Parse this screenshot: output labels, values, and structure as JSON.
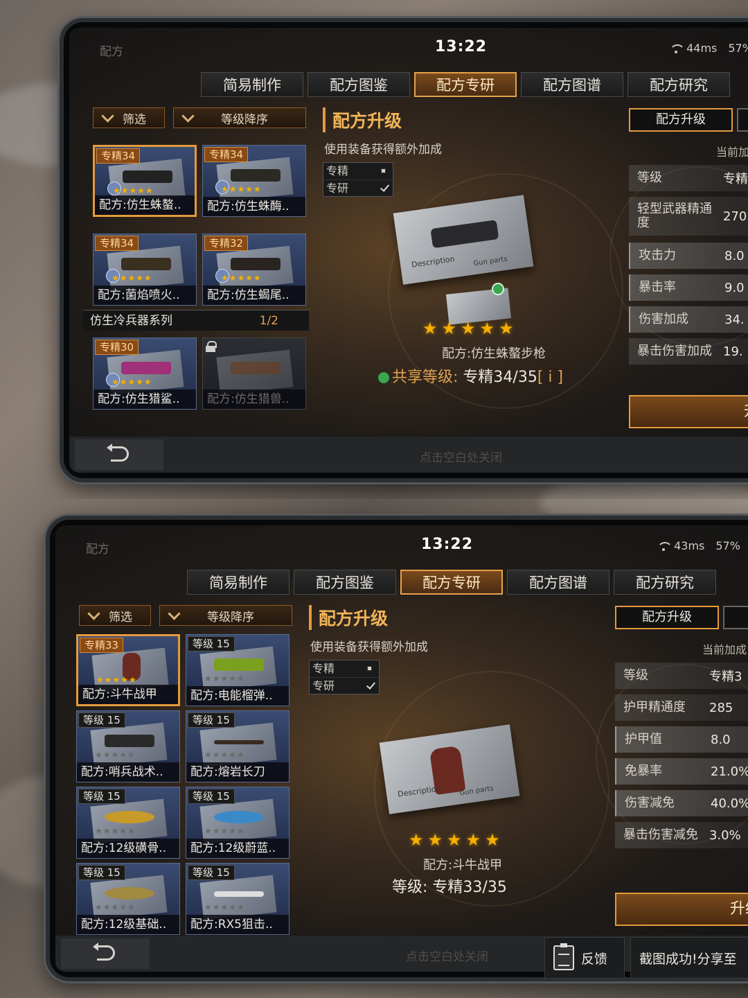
{
  "screenshots": [
    {
      "app_title": "配方",
      "clock": "13:22",
      "ping": "44ms",
      "battery": "57%",
      "tabs": [
        "简易制作",
        "配方图鉴",
        "配方专研",
        "配方图谱",
        "配方研究"
      ],
      "active_tab": "配方专研",
      "filter_label": "筛选",
      "sort_label": "等级降序",
      "cards": [
        {
          "level": "专精34",
          "name": "配方:仿生蛛螯..",
          "selected": true,
          "locked": false,
          "star_count": 5
        },
        {
          "level": "专精34",
          "name": "配方:仿生蛛酶..",
          "selected": false,
          "locked": false,
          "star_count": 5
        },
        {
          "level": "专精34",
          "name": "配方:菌焰喷火..",
          "selected": false,
          "locked": false,
          "star_count": 5
        },
        {
          "level": "专精32",
          "name": "配方:仿生蝎尾..",
          "selected": false,
          "locked": false,
          "star_count": 5
        },
        {
          "level": "专精30",
          "name": "配方:仿生猎鲨..",
          "selected": false,
          "locked": false,
          "star_count": 5
        },
        {
          "level": "",
          "name": "配方:仿生猎兽..",
          "selected": false,
          "locked": true,
          "star_count": 0
        }
      ],
      "series": {
        "name": "仿生冷兵器系列",
        "count": "1/2"
      },
      "section_title": "配方升级",
      "section_subtitle": "使用装备获得额外加成",
      "toggles": [
        "专精",
        "专研"
      ],
      "item_name": "配方:仿生蛛螯步枪",
      "star_count": 5,
      "level_label": "共享等级:",
      "level_value": "专精34/35",
      "info_marker": "[ i ]",
      "right_tab": "配方升级",
      "current_bonus_label": "当前加",
      "stats": [
        {
          "label": "等级",
          "value": "专精"
        },
        {
          "label": "轻型武器精通度",
          "value": "270"
        },
        {
          "label": "攻击力",
          "value": "8.0"
        },
        {
          "label": "暴击率",
          "value": "9.0"
        },
        {
          "label": "伤害加成",
          "value": "34."
        },
        {
          "label": "暴击伤害加成",
          "value": "19."
        }
      ],
      "upgrade_label": "升级",
      "close_hint": "点击空白处关闭"
    },
    {
      "app_title": "配方",
      "clock": "13:22",
      "ping": "43ms",
      "battery": "57%",
      "tabs": [
        "简易制作",
        "配方图鉴",
        "配方专研",
        "配方图谱",
        "配方研究"
      ],
      "active_tab": "配方专研",
      "filter_label": "筛选",
      "sort_label": "等级降序",
      "cards": [
        {
          "level": "专精33",
          "name": "配方:斗牛战甲",
          "selected": true,
          "locked": false,
          "star_count": 5
        },
        {
          "level": "等级 15",
          "name": "配方:电能榴弹..",
          "selected": false,
          "locked": false,
          "star_count": 0
        },
        {
          "level": "等级 15",
          "name": "配方:哨兵战术..",
          "selected": false,
          "locked": false,
          "star_count": 0
        },
        {
          "level": "等级 15",
          "name": "配方:熔岩长刀",
          "selected": false,
          "locked": false,
          "star_count": 0
        },
        {
          "level": "等级 15",
          "name": "配方:12级磺骨..",
          "selected": false,
          "locked": false,
          "star_count": 0
        },
        {
          "level": "等级 15",
          "name": "配方:12级蔚蓝..",
          "selected": false,
          "locked": false,
          "star_count": 0
        },
        {
          "level": "等级 15",
          "name": "配方:12级基础..",
          "selected": false,
          "locked": false,
          "star_count": 0
        },
        {
          "level": "等级 15",
          "name": "配方:RX5狙击..",
          "selected": false,
          "locked": false,
          "star_count": 0
        }
      ],
      "section_title": "配方升级",
      "section_subtitle": "使用装备获得额外加成",
      "toggles": [
        "专精",
        "专研"
      ],
      "item_name": "配方:斗牛战甲",
      "star_count": 5,
      "level_label": "等级:",
      "level_value": "专精33/35",
      "right_tab": "配方升级",
      "current_bonus_label": "当前加成",
      "stats": [
        {
          "label": "等级",
          "value": "专精3"
        },
        {
          "label": "护甲精通度",
          "value": "285"
        },
        {
          "label": "护甲值",
          "value": "8.0"
        },
        {
          "label": "免暴率",
          "value": "21.0%"
        },
        {
          "label": "伤害减免",
          "value": "40.0%"
        },
        {
          "label": "暴击伤害减免",
          "value": "3.0%"
        }
      ],
      "upgrade_label": "升级",
      "close_hint": "点击空白处关闭",
      "feedback_label": "反馈",
      "share_label": "截图成功!分享至"
    }
  ]
}
